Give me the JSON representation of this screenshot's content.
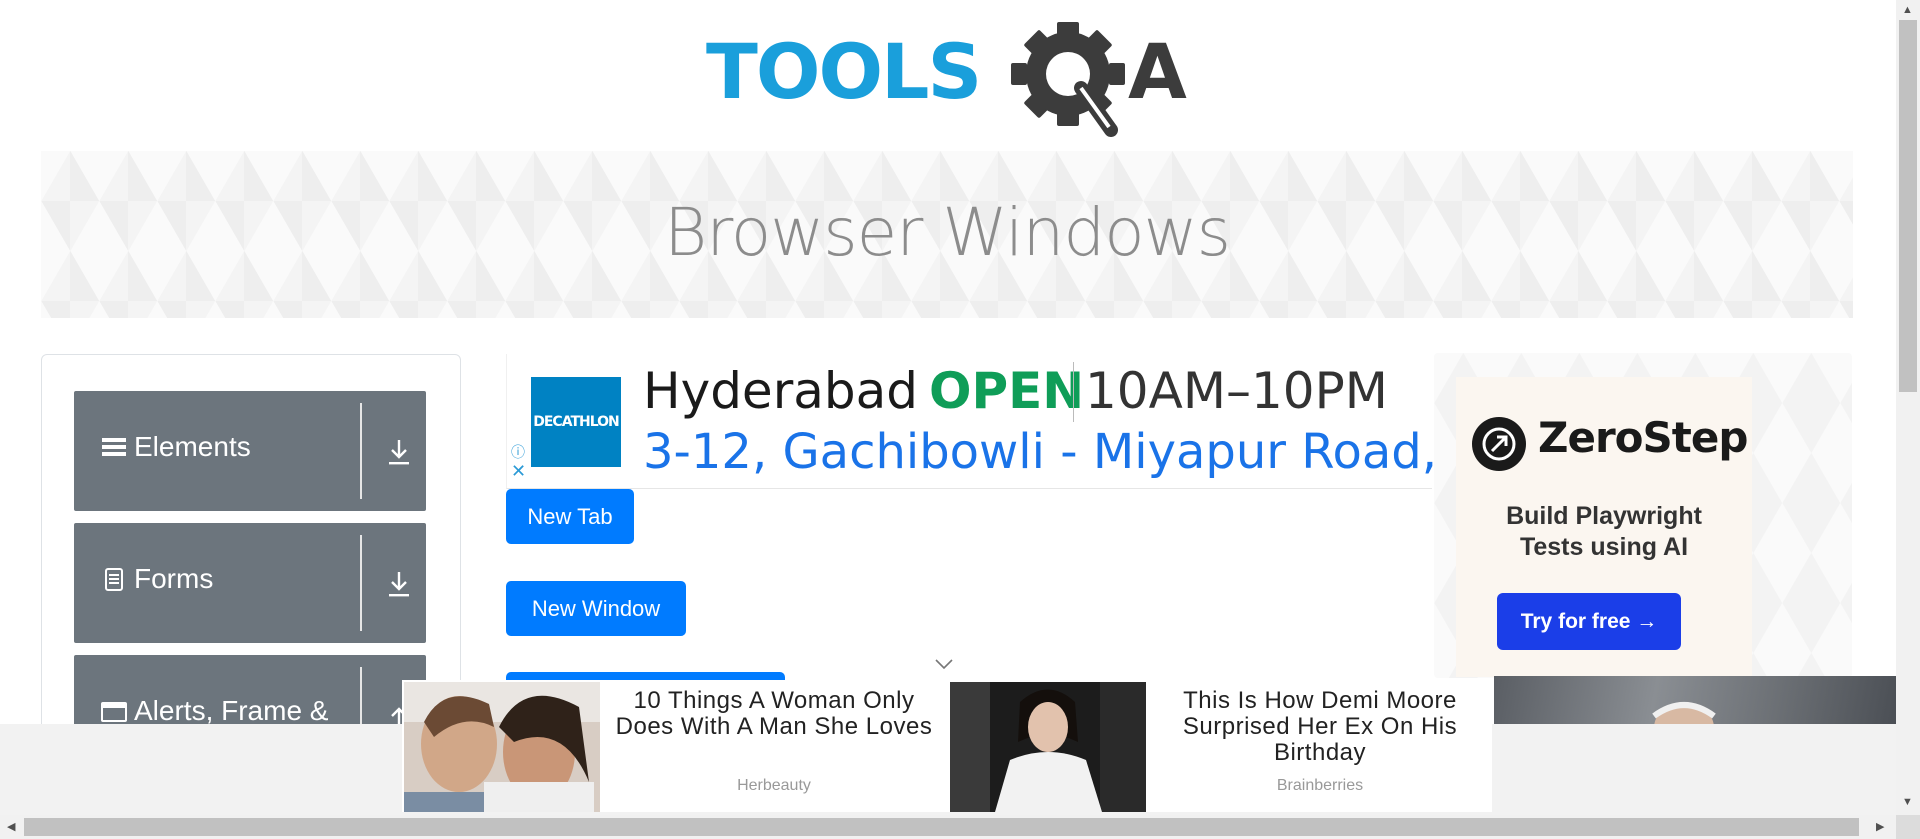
{
  "logo": {
    "word": "TOOLS",
    "letter": "A"
  },
  "banner": {
    "title": "Browser Windows"
  },
  "menu": {
    "groups": [
      {
        "label": "Elements",
        "icon": "menu-bars-icon",
        "arrow": "download-arrow-icon"
      },
      {
        "label": "Forms",
        "icon": "document-icon",
        "arrow": "download-arrow-icon"
      },
      {
        "label": "Alerts, Frame &",
        "icon": "window-icon",
        "arrow": "up-arrow-icon"
      }
    ]
  },
  "ad_top": {
    "brand": "DECATHLON",
    "city": "Hyderabad",
    "status": "OPEN",
    "hours": "10AM–10PM",
    "address": "3-12, Gachibowli - Miyapur Road,...",
    "status_color": "#0f9d58",
    "address_color": "#1a73e8"
  },
  "buttons": {
    "new_tab": "New Tab",
    "new_window": "New Window",
    "accent_color": "#007bff"
  },
  "ad_right": {
    "brand": "ZeroStep",
    "tagline_line1": "Build Playwright",
    "tagline_line2": "Tests using AI",
    "cta": "Try for free →",
    "cta_color": "#1b3ee8"
  },
  "bottom_ad": {
    "items": [
      {
        "headline": "10 Things A Woman Only Does With A Man She Loves",
        "source": "Herbeauty"
      },
      {
        "headline": "This Is How Demi Moore Surprised Her Ex On His Birthday",
        "source": "Brainberries"
      }
    ]
  }
}
